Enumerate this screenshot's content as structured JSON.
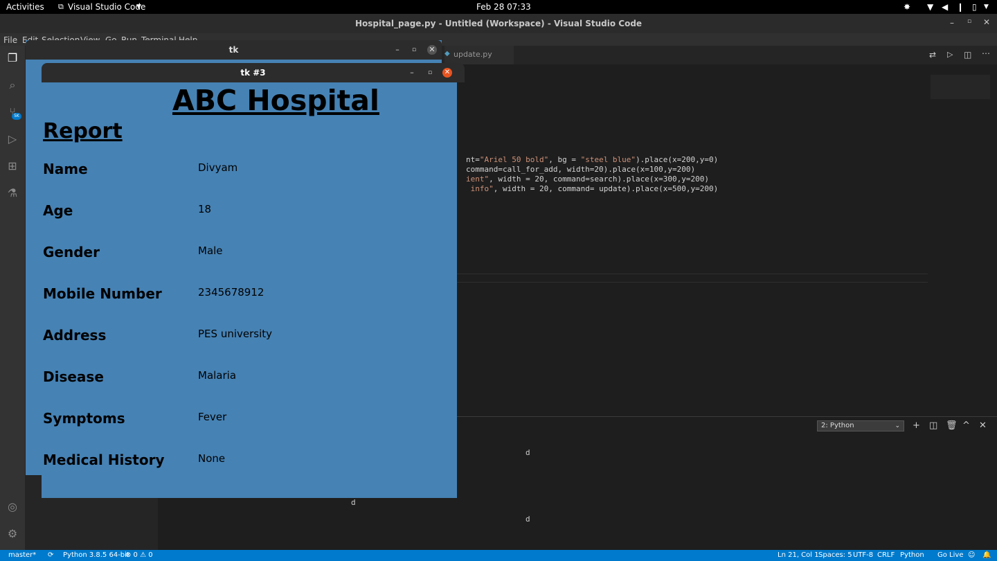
{
  "topbar": {
    "activities": "Activities",
    "app_name": "Visual Studio Code",
    "clock": "Feb 28  07:33"
  },
  "vscode": {
    "window_title": "Hospital_page.py - Untitled (Workspace) - Visual Studio Code",
    "menu": [
      "File",
      "Edit",
      "Selection",
      "View",
      "Go",
      "Run",
      "Terminal",
      "Help"
    ],
    "tab_label": "update.py",
    "code_lines": [
      {
        "a": "nt=",
        "b": "\"Ariel 50 bold\"",
        "c": ", bg = ",
        "d": "\"steel blue\"",
        "e": ").place(x=200,y=0)"
      },
      {
        "a": "command=call_for_add, width=20).place(x=100,y=200)",
        "b": "",
        "c": "",
        "d": "",
        "e": ""
      },
      {
        "a": "",
        "b": "ient\"",
        "c": ", width = 20, command=search).place(x=300,y=200)",
        "d": "",
        "e": ""
      },
      {
        "a": "",
        "b": " info\"",
        "c": ", width = 20, command= update).place(x=500,y=200)",
        "d": "",
        "e": ""
      }
    ],
    "terminal_select": "2: Python",
    "terminal_output": [
      "d",
      "d",
      "d"
    ],
    "activity_badge": "5K",
    "status": {
      "branch": "master*",
      "python": "Python 3.8.5 64-bit",
      "problems": "⊗ 0 ⚠ 0",
      "position": "Ln 21, Col 1",
      "spaces": "Spaces: 5",
      "encoding": "UTF-8",
      "eol": "CRLF",
      "language": "Python",
      "golive": "Go Live"
    }
  },
  "tk1": {
    "title": "tk"
  },
  "tk3": {
    "title": "tk #3",
    "hospital_name": "ABC Hospital",
    "report_heading": "Report",
    "fields": [
      {
        "label": "Name",
        "value": "Divyam"
      },
      {
        "label": "Age",
        "value": "18"
      },
      {
        "label": "Gender",
        "value": "Male"
      },
      {
        "label": "Mobile Number",
        "value": "2345678912"
      },
      {
        "label": "Address",
        "value": "PES university"
      },
      {
        "label": "Disease",
        "value": "Malaria"
      },
      {
        "label": "Symptoms",
        "value": "Fever"
      },
      {
        "label": "Medical History",
        "value": "None"
      }
    ]
  },
  "colors": {
    "tk_background": "#4682b4",
    "statusbar": "#007acc",
    "editor_bg": "#1e1e1e"
  }
}
